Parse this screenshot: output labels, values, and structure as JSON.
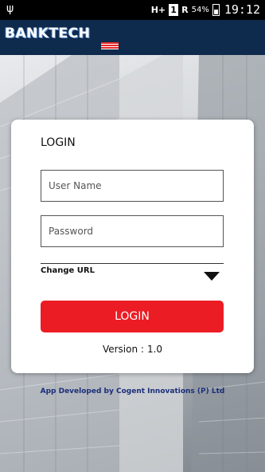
{
  "status_bar": {
    "usb_icon": "usb-icon",
    "network_type": "H+",
    "sim_slot": "1",
    "roaming": "R",
    "battery_percent": "54%",
    "time": "19:12"
  },
  "header": {
    "logo_text": "BANKTECH",
    "colors": {
      "background": "#0e2a4d"
    }
  },
  "login_card": {
    "title": "LOGIN",
    "username": {
      "value": "",
      "placeholder": "User Name"
    },
    "password": {
      "value": "",
      "placeholder": "Password"
    },
    "change_url_label": "Change URL",
    "login_button_label": "LOGIN",
    "version_label": "Version :",
    "version_number": "1.0",
    "colors": {
      "button": "#ec1c24"
    }
  },
  "footer": {
    "credit": "App Developed by Cogent Innovations (P) Ltd"
  }
}
